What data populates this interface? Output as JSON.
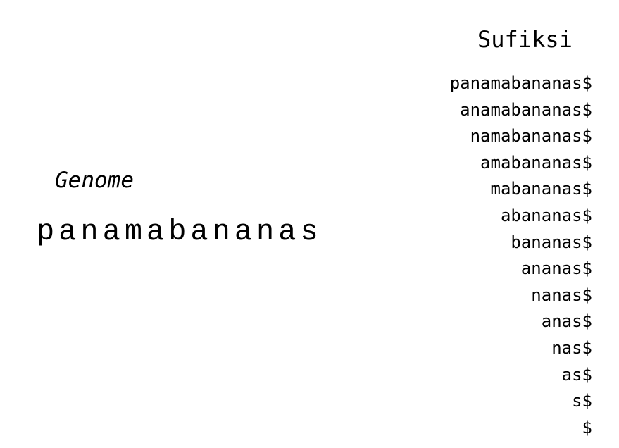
{
  "genome": {
    "label": "Genome",
    "sequence": "panamabananas"
  },
  "suffixes": {
    "title": "Sufiksi",
    "items": [
      "panamabananas$",
      "anamabananas$",
      "namabananas$",
      "amabananas$",
      "mabananas$",
      "abananas$",
      "bananas$",
      "ananas$",
      "nanas$",
      "anas$",
      "nas$",
      "as$",
      "s$",
      "$"
    ]
  }
}
